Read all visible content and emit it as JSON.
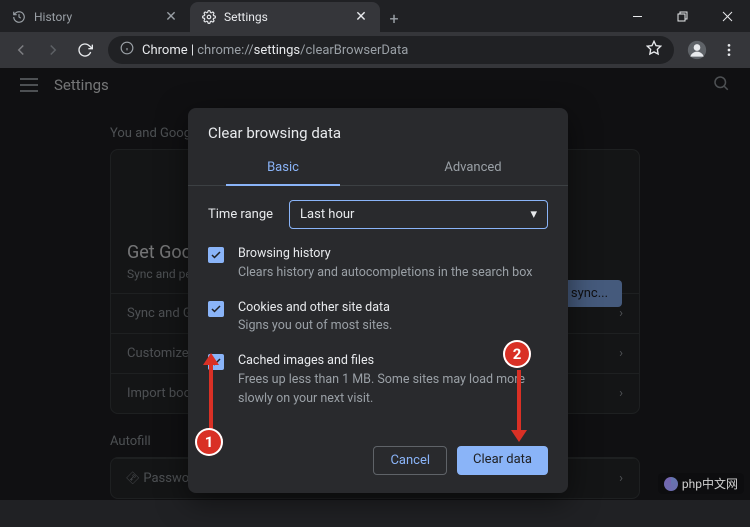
{
  "window": {
    "tabs": [
      {
        "title": "History",
        "favicon": "history"
      },
      {
        "title": "Settings",
        "favicon": "gear"
      }
    ],
    "controls": {
      "minimize": "—",
      "maximize": "❐",
      "close": "✕"
    }
  },
  "toolbar": {
    "url_prefix": "Chrome",
    "url_dim1": "chrome://",
    "url_bold": "settings",
    "url_dim2": "/clearBrowserData"
  },
  "settings": {
    "header": "Settings",
    "section_you": "You and Google",
    "card_title": "Get Google smarts in Chrome",
    "card_sub": "Sync and personalize Chrome across your devices",
    "sync_btn": "Turn on sync...",
    "rows": [
      "Sync and Google services",
      "Customize your Chrome profile",
      "Import bookmarks and settings"
    ],
    "section_autofill": "Autofill",
    "autofill_row": "Passwords"
  },
  "dialog": {
    "title": "Clear browsing data",
    "tabs": {
      "basic": "Basic",
      "advanced": "Advanced"
    },
    "time_range_label": "Time range",
    "time_range_value": "Last hour",
    "items": [
      {
        "label": "Browsing history",
        "sub": "Clears history and autocompletions in the search box"
      },
      {
        "label": "Cookies and other site data",
        "sub": "Signs you out of most sites."
      },
      {
        "label": "Cached images and files",
        "sub": "Frees up less than 1 MB. Some sites may load more slowly on your next visit."
      }
    ],
    "cancel": "Cancel",
    "confirm": "Clear data"
  },
  "annotations": {
    "one": "1",
    "two": "2"
  },
  "watermark": "php中文网"
}
